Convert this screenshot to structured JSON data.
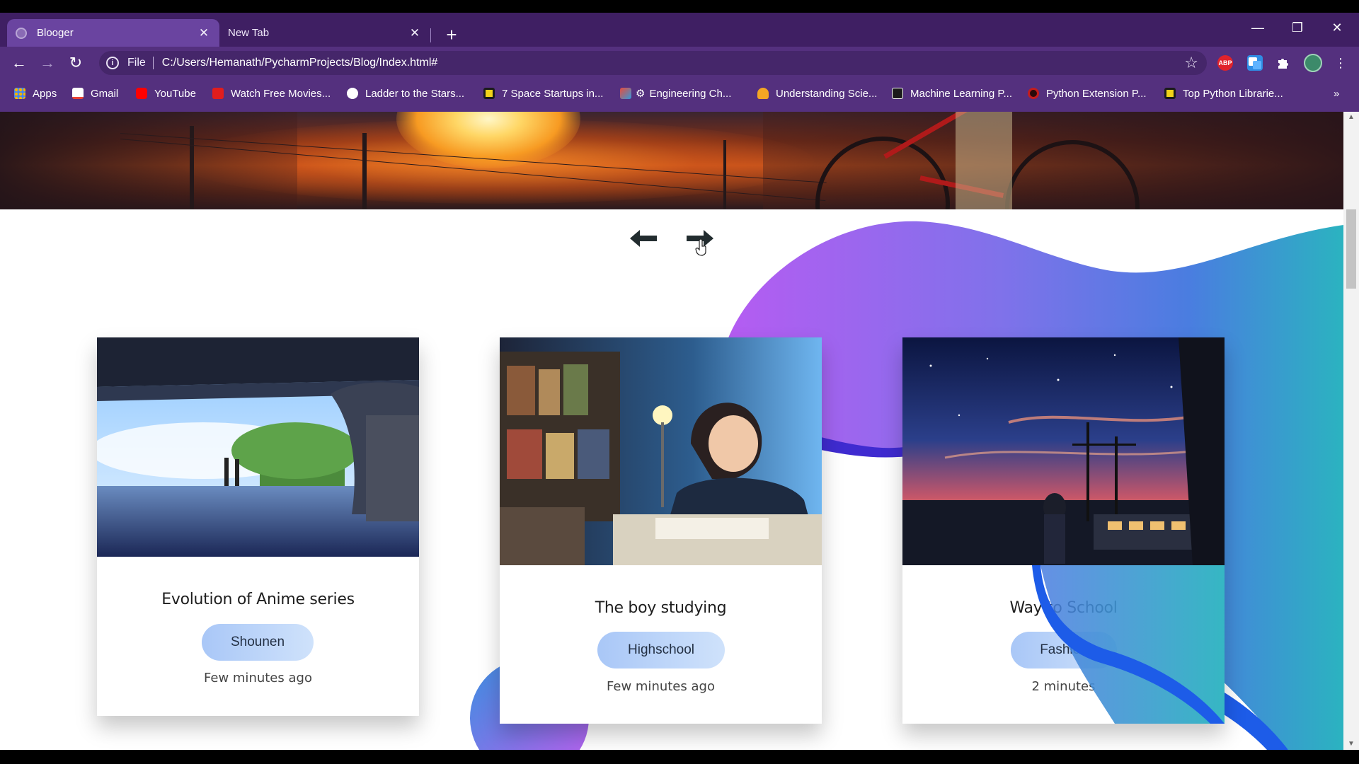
{
  "browser": {
    "tabs": [
      {
        "title": "Blooger",
        "active": true
      },
      {
        "title": "New Tab",
        "active": false
      }
    ],
    "address": {
      "scheme_label": "File",
      "url": "C:/Users/Hemanath/PycharmProjects/Blog/Index.html#"
    },
    "extensions": [
      {
        "name": "adblock-plus-icon",
        "label": "ABP",
        "color": "#e1232b"
      },
      {
        "name": "translate-extension-icon",
        "label": "",
        "color": "#2f8de4"
      },
      {
        "name": "extensions-puzzle-icon",
        "label": "",
        "color": "#ffffff"
      },
      {
        "name": "profile-avatar-icon",
        "label": "",
        "color": "#3c8a6a"
      }
    ],
    "bookmarks": [
      {
        "label": "Apps",
        "icon": "apps-grid-icon",
        "color": "#e44d4d"
      },
      {
        "label": "Gmail",
        "icon": "gmail-icon",
        "color": "#ea4335"
      },
      {
        "label": "YouTube",
        "icon": "youtube-icon",
        "color": "#ff0000"
      },
      {
        "label": "Watch Free Movies...",
        "icon": "play-icon",
        "color": "#e11d1d"
      },
      {
        "label": "Ladder to the Stars...",
        "icon": "rocket-icon",
        "color": "#ffffff"
      },
      {
        "label": "7 Space Startups in...",
        "icon": "yellow-square-icon",
        "color": "#f2d21a"
      },
      {
        "label": "Engineering Ch...",
        "icon": "gear-icon",
        "color": "#ffffff"
      },
      {
        "label": "Understanding Scie...",
        "icon": "flame-icon",
        "color": "#f5a623"
      },
      {
        "label": "Machine Learning P...",
        "icon": "angular-icon",
        "color": "#ffffff"
      },
      {
        "label": "Python Extension P...",
        "icon": "python-x-icon",
        "color": "#c41d1d"
      },
      {
        "label": "Top Python Librarie...",
        "icon": "yellow-square-icon",
        "color": "#f2d21a"
      }
    ],
    "overflow_label": "»"
  },
  "page": {
    "carousel": {
      "prev": "previous-arrow",
      "next": "next-arrow"
    },
    "cards": [
      {
        "title": "Evolution of Anime series",
        "tag": "Shounen",
        "time": "Few minutes ago"
      },
      {
        "title": "The boy studying",
        "tag": "Highschool",
        "time": "Few minutes ago"
      },
      {
        "title": "Way to School",
        "tag": "Fashion",
        "time": "2 minutes"
      }
    ],
    "colors": {
      "blob_purple": "#b55cf2",
      "blob_blue": "#4a7de0",
      "blob_teal": "#2bb3c0",
      "tag_bg": "#b8d3f8",
      "arrow": "#222c2f"
    }
  }
}
